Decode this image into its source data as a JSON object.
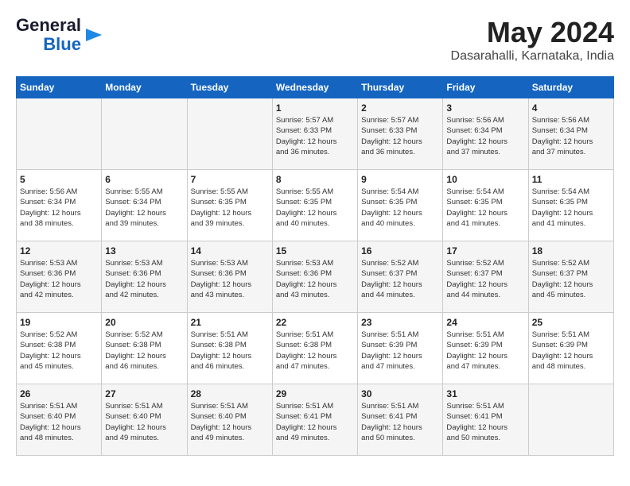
{
  "header": {
    "logo_line1": "General",
    "logo_line2": "Blue",
    "title": "May 2024",
    "subtitle": "Dasarahalli, Karnataka, India"
  },
  "weekdays": [
    "Sunday",
    "Monday",
    "Tuesday",
    "Wednesday",
    "Thursday",
    "Friday",
    "Saturday"
  ],
  "weeks": [
    [
      {
        "day": "",
        "info": ""
      },
      {
        "day": "",
        "info": ""
      },
      {
        "day": "",
        "info": ""
      },
      {
        "day": "1",
        "info": "Sunrise: 5:57 AM\nSunset: 6:33 PM\nDaylight: 12 hours\nand 36 minutes."
      },
      {
        "day": "2",
        "info": "Sunrise: 5:57 AM\nSunset: 6:33 PM\nDaylight: 12 hours\nand 36 minutes."
      },
      {
        "day": "3",
        "info": "Sunrise: 5:56 AM\nSunset: 6:34 PM\nDaylight: 12 hours\nand 37 minutes."
      },
      {
        "day": "4",
        "info": "Sunrise: 5:56 AM\nSunset: 6:34 PM\nDaylight: 12 hours\nand 37 minutes."
      }
    ],
    [
      {
        "day": "5",
        "info": "Sunrise: 5:56 AM\nSunset: 6:34 PM\nDaylight: 12 hours\nand 38 minutes."
      },
      {
        "day": "6",
        "info": "Sunrise: 5:55 AM\nSunset: 6:34 PM\nDaylight: 12 hours\nand 39 minutes."
      },
      {
        "day": "7",
        "info": "Sunrise: 5:55 AM\nSunset: 6:35 PM\nDaylight: 12 hours\nand 39 minutes."
      },
      {
        "day": "8",
        "info": "Sunrise: 5:55 AM\nSunset: 6:35 PM\nDaylight: 12 hours\nand 40 minutes."
      },
      {
        "day": "9",
        "info": "Sunrise: 5:54 AM\nSunset: 6:35 PM\nDaylight: 12 hours\nand 40 minutes."
      },
      {
        "day": "10",
        "info": "Sunrise: 5:54 AM\nSunset: 6:35 PM\nDaylight: 12 hours\nand 41 minutes."
      },
      {
        "day": "11",
        "info": "Sunrise: 5:54 AM\nSunset: 6:35 PM\nDaylight: 12 hours\nand 41 minutes."
      }
    ],
    [
      {
        "day": "12",
        "info": "Sunrise: 5:53 AM\nSunset: 6:36 PM\nDaylight: 12 hours\nand 42 minutes."
      },
      {
        "day": "13",
        "info": "Sunrise: 5:53 AM\nSunset: 6:36 PM\nDaylight: 12 hours\nand 42 minutes."
      },
      {
        "day": "14",
        "info": "Sunrise: 5:53 AM\nSunset: 6:36 PM\nDaylight: 12 hours\nand 43 minutes."
      },
      {
        "day": "15",
        "info": "Sunrise: 5:53 AM\nSunset: 6:36 PM\nDaylight: 12 hours\nand 43 minutes."
      },
      {
        "day": "16",
        "info": "Sunrise: 5:52 AM\nSunset: 6:37 PM\nDaylight: 12 hours\nand 44 minutes."
      },
      {
        "day": "17",
        "info": "Sunrise: 5:52 AM\nSunset: 6:37 PM\nDaylight: 12 hours\nand 44 minutes."
      },
      {
        "day": "18",
        "info": "Sunrise: 5:52 AM\nSunset: 6:37 PM\nDaylight: 12 hours\nand 45 minutes."
      }
    ],
    [
      {
        "day": "19",
        "info": "Sunrise: 5:52 AM\nSunset: 6:38 PM\nDaylight: 12 hours\nand 45 minutes."
      },
      {
        "day": "20",
        "info": "Sunrise: 5:52 AM\nSunset: 6:38 PM\nDaylight: 12 hours\nand 46 minutes."
      },
      {
        "day": "21",
        "info": "Sunrise: 5:51 AM\nSunset: 6:38 PM\nDaylight: 12 hours\nand 46 minutes."
      },
      {
        "day": "22",
        "info": "Sunrise: 5:51 AM\nSunset: 6:38 PM\nDaylight: 12 hours\nand 47 minutes."
      },
      {
        "day": "23",
        "info": "Sunrise: 5:51 AM\nSunset: 6:39 PM\nDaylight: 12 hours\nand 47 minutes."
      },
      {
        "day": "24",
        "info": "Sunrise: 5:51 AM\nSunset: 6:39 PM\nDaylight: 12 hours\nand 47 minutes."
      },
      {
        "day": "25",
        "info": "Sunrise: 5:51 AM\nSunset: 6:39 PM\nDaylight: 12 hours\nand 48 minutes."
      }
    ],
    [
      {
        "day": "26",
        "info": "Sunrise: 5:51 AM\nSunset: 6:40 PM\nDaylight: 12 hours\nand 48 minutes."
      },
      {
        "day": "27",
        "info": "Sunrise: 5:51 AM\nSunset: 6:40 PM\nDaylight: 12 hours\nand 49 minutes."
      },
      {
        "day": "28",
        "info": "Sunrise: 5:51 AM\nSunset: 6:40 PM\nDaylight: 12 hours\nand 49 minutes."
      },
      {
        "day": "29",
        "info": "Sunrise: 5:51 AM\nSunset: 6:41 PM\nDaylight: 12 hours\nand 49 minutes."
      },
      {
        "day": "30",
        "info": "Sunrise: 5:51 AM\nSunset: 6:41 PM\nDaylight: 12 hours\nand 50 minutes."
      },
      {
        "day": "31",
        "info": "Sunrise: 5:51 AM\nSunset: 6:41 PM\nDaylight: 12 hours\nand 50 minutes."
      },
      {
        "day": "",
        "info": ""
      }
    ]
  ]
}
